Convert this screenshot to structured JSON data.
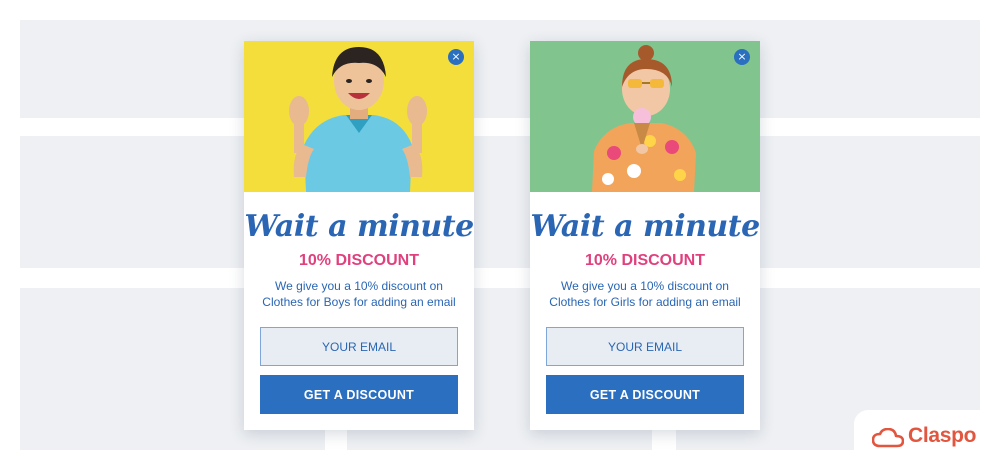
{
  "popups": [
    {
      "title": "Wait a minute",
      "discount": "10% DISCOUNT",
      "description": "We give you a 10% discount on Clothes for Boys for adding an email",
      "email_placeholder": "YOUR EMAIL",
      "cta_label": "GET A DISCOUNT",
      "close_icon": "×",
      "photo_background": "#f3de3c"
    },
    {
      "title": "Wait a minute",
      "discount": "10% DISCOUNT",
      "description": "We give you a 10% discount on Clothes for Girls for adding an email",
      "email_placeholder": "YOUR EMAIL",
      "cta_label": "GET A DISCOUNT",
      "close_icon": "×",
      "photo_background": "#82c48e"
    }
  ],
  "brand": {
    "name": "Claspo",
    "color": "#e2553e",
    "icon": "cloud-icon"
  },
  "colors": {
    "primary": "#2a6fc0",
    "accent": "#e0407e",
    "text": "#2a66b4"
  }
}
